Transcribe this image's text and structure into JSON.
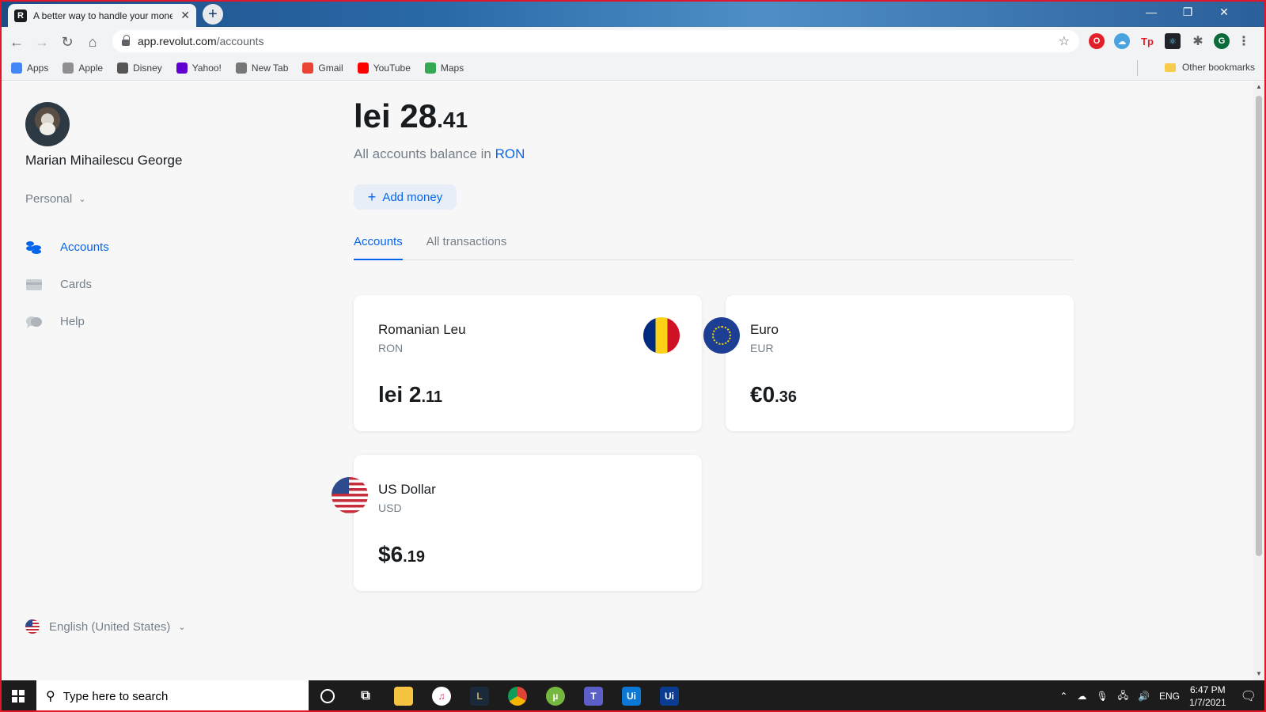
{
  "browser": {
    "tab_title": "A better way to handle your money",
    "tab_favicon": "R",
    "url_host": "app.revolut.com",
    "url_path": "/accounts",
    "bookmarks": [
      {
        "label": "Apps",
        "icon": "apps-grid-icon",
        "color": "#4285f4"
      },
      {
        "label": "Apple",
        "icon": "apple-icon",
        "color": "#8e8e93"
      },
      {
        "label": "Disney",
        "icon": "disney-icon",
        "color": "#555555"
      },
      {
        "label": "Yahoo!",
        "icon": "yahoo-icon",
        "color": "#6001d2"
      },
      {
        "label": "New Tab",
        "icon": "globe-icon",
        "color": "#777777"
      },
      {
        "label": "Gmail",
        "icon": "gmail-icon",
        "color": "#ea4335"
      },
      {
        "label": "YouTube",
        "icon": "youtube-icon",
        "color": "#ff0000"
      },
      {
        "label": "Maps",
        "icon": "maps-icon",
        "color": "#34a853"
      }
    ],
    "other_bookmarks": "Other bookmarks"
  },
  "sidebar": {
    "user_name": "Marian Mihailescu George",
    "profile_type": "Personal",
    "nav": [
      {
        "label": "Accounts",
        "icon": "coins-stack-icon",
        "active": true
      },
      {
        "label": "Cards",
        "icon": "card-icon",
        "active": false
      },
      {
        "label": "Help",
        "icon": "chat-bubbles-icon",
        "active": false
      }
    ],
    "language": "English (United States)"
  },
  "main": {
    "balance_currency": "lei",
    "balance_int": "28",
    "balance_dec": ".41",
    "subtitle_prefix": "All accounts balance in",
    "subtitle_currency": "RON",
    "add_money_label": "Add money",
    "tabs": [
      {
        "label": "Accounts",
        "active": true
      },
      {
        "label": "All transactions",
        "active": false
      }
    ],
    "accounts": [
      {
        "name": "Romanian Leu",
        "code": "RON",
        "amount_int": "lei 2",
        "amount_dec": ".11",
        "flag": "romania-flag-icon"
      },
      {
        "name": "Euro",
        "code": "EUR",
        "amount_int": "€0",
        "amount_dec": ".36",
        "flag": "eu-flag-icon"
      },
      {
        "name": "US Dollar",
        "code": "USD",
        "amount_int": "$6",
        "amount_dec": ".19",
        "flag": "us-flag-icon"
      }
    ]
  },
  "taskbar": {
    "search_placeholder": "Type here to search",
    "lang": "ENG",
    "time": "6:47 PM",
    "date": "1/7/2021"
  },
  "colors": {
    "accent": "#0666eb",
    "muted_text": "#75808a",
    "page_bg": "#f7f7f8"
  }
}
